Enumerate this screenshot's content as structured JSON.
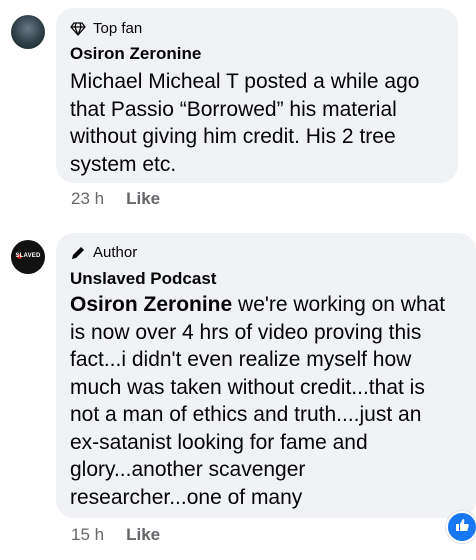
{
  "comments": [
    {
      "badge": "Top fan",
      "badge_icon": "diamond-icon",
      "author": "Osiron Zeronine",
      "lines": [
        "Michael Micheal T posted a while ago",
        "that Passio “Borrowed” his material",
        "without giving him credit. His 2 tree",
        "system etc."
      ],
      "time": "23 h",
      "like_label": "Like"
    },
    {
      "badge": "Author",
      "badge_icon": "pencil-icon",
      "author": "Unslaved Podcast",
      "avatar_text": "SLAVED",
      "mention": "Osiron Zeronine",
      "first_line_rest": " we're working on what",
      "lines": [
        "is now over 4 hrs of video proving this",
        "fact...i didn't even realize myself how",
        "much was taken without credit...that is",
        "not a man of ethics and truth....just an",
        "ex-satanist looking for fame and",
        "glory...another scavenger",
        "researcher...one of many"
      ],
      "time": "15 h",
      "like_label": "Like"
    }
  ],
  "reaction_icon": "thumbs-up-icon",
  "colors": {
    "bubble": "#f0f2f5",
    "meta": "#65676b",
    "reaction": "#1877f2"
  }
}
